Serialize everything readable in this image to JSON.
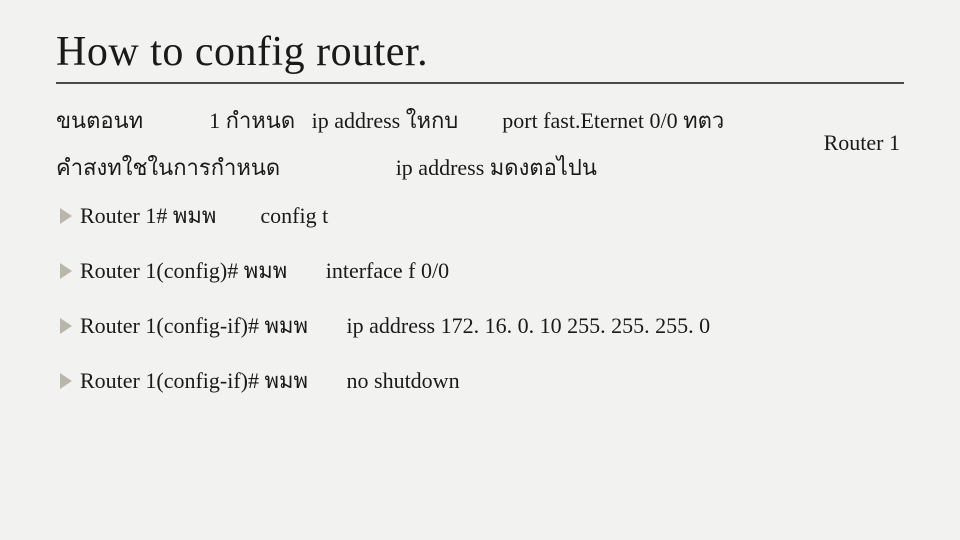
{
  "title": "How to config router.",
  "line1": "ขนตอนท            1 กำหนด   ip address ใหกบ        port fast.Eternet 0/0 ทตว",
  "router_label": "Router 1",
  "line2": "คำสงทใชในการกำหนด                     ip address มดงตอไปน",
  "bullets": [
    "Router 1# พมพ        config t",
    "Router 1(config)# พมพ       interface f 0/0",
    "Router 1(config-if)# พมพ       ip address 172. 16. 0. 10 255. 255. 255. 0",
    "Router 1(config-if)# พมพ       no shutdown"
  ]
}
